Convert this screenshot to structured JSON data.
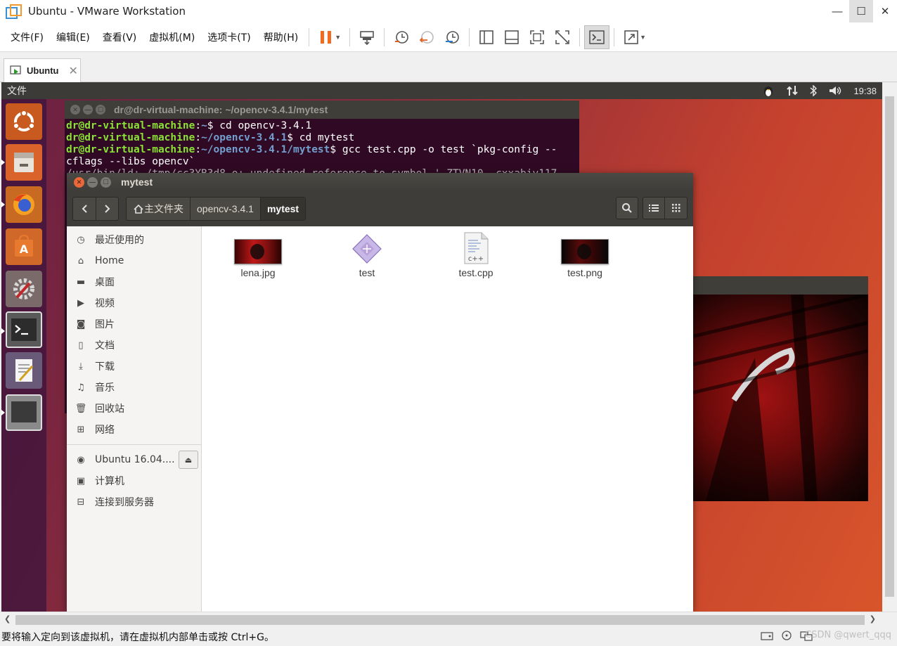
{
  "window": {
    "title": "Ubuntu - VMware Workstation",
    "minimize": "—",
    "maximize": "☐",
    "close": "✕"
  },
  "menu": [
    "文件(F)",
    "编辑(E)",
    "查看(V)",
    "虚拟机(M)",
    "选项卡(T)",
    "帮助(H)"
  ],
  "tab": {
    "label": "Ubuntu",
    "close": "✕"
  },
  "ubuntu_topbar": {
    "menu": "文件",
    "time": "19:38"
  },
  "terminal": {
    "title": "dr@dr-virtual-machine: ~/opencv-3.4.1/mytest",
    "lines": [
      {
        "user": "dr@dr-virtual-machine",
        "path": "~",
        "cmd": "$ cd opencv-3.4.1"
      },
      {
        "user": "dr@dr-virtual-machine",
        "path": "~/opencv-3.4.1",
        "cmd": "$ cd mytest"
      },
      {
        "user": "dr@dr-virtual-machine",
        "path": "~/opencv-3.4.1/mytest",
        "cmd": "$ gcc test.cpp -o test `pkg-config --"
      }
    ],
    "continuation": "cflags --libs opencv`",
    "partial": "/usr/bin/ld: /tmp/cc3YB3d8.o: undefined reference to symbol '_ZTVN10__cxxabiv117"
  },
  "files": {
    "title": "mytest",
    "breadcrumbs": [
      "主文件夹",
      "opencv-3.4.1",
      "mytest"
    ],
    "sidebar": [
      {
        "icon": "clock-icon",
        "glyph": "◷",
        "label": "最近使用的"
      },
      {
        "icon": "home-icon",
        "glyph": "⌂",
        "label": "Home"
      },
      {
        "icon": "folder-icon",
        "glyph": "▬",
        "label": "桌面"
      },
      {
        "icon": "video-icon",
        "glyph": "▶",
        "label": "视频"
      },
      {
        "icon": "camera-icon",
        "glyph": "◙",
        "label": "图片"
      },
      {
        "icon": "document-icon",
        "glyph": "▯",
        "label": "文档"
      },
      {
        "icon": "download-icon",
        "glyph": "⤓",
        "label": "下载"
      },
      {
        "icon": "music-icon",
        "glyph": "♫",
        "label": "音乐"
      },
      {
        "icon": "trash-icon",
        "glyph": "🗑",
        "label": "回收站"
      },
      {
        "icon": "network-icon",
        "glyph": "⊞",
        "label": "网络"
      }
    ],
    "devices": [
      {
        "icon": "disc-icon",
        "glyph": "◉",
        "label": "Ubuntu 16.04...."
      },
      {
        "icon": "computer-icon",
        "glyph": "▣",
        "label": "计算机"
      },
      {
        "icon": "server-icon",
        "glyph": "⊟",
        "label": "连接到服务器"
      }
    ],
    "items": [
      {
        "name": "lena.jpg",
        "kind": "image"
      },
      {
        "name": "test",
        "kind": "executable"
      },
      {
        "name": "test.cpp",
        "kind": "source"
      },
      {
        "name": "test.png",
        "kind": "image-dark"
      }
    ]
  },
  "status": {
    "text": "要将输入定向到该虚拟机，请在虚拟机内部单击或按 Ctrl+G。",
    "watermark": "CSDN @qwert_qqq"
  }
}
